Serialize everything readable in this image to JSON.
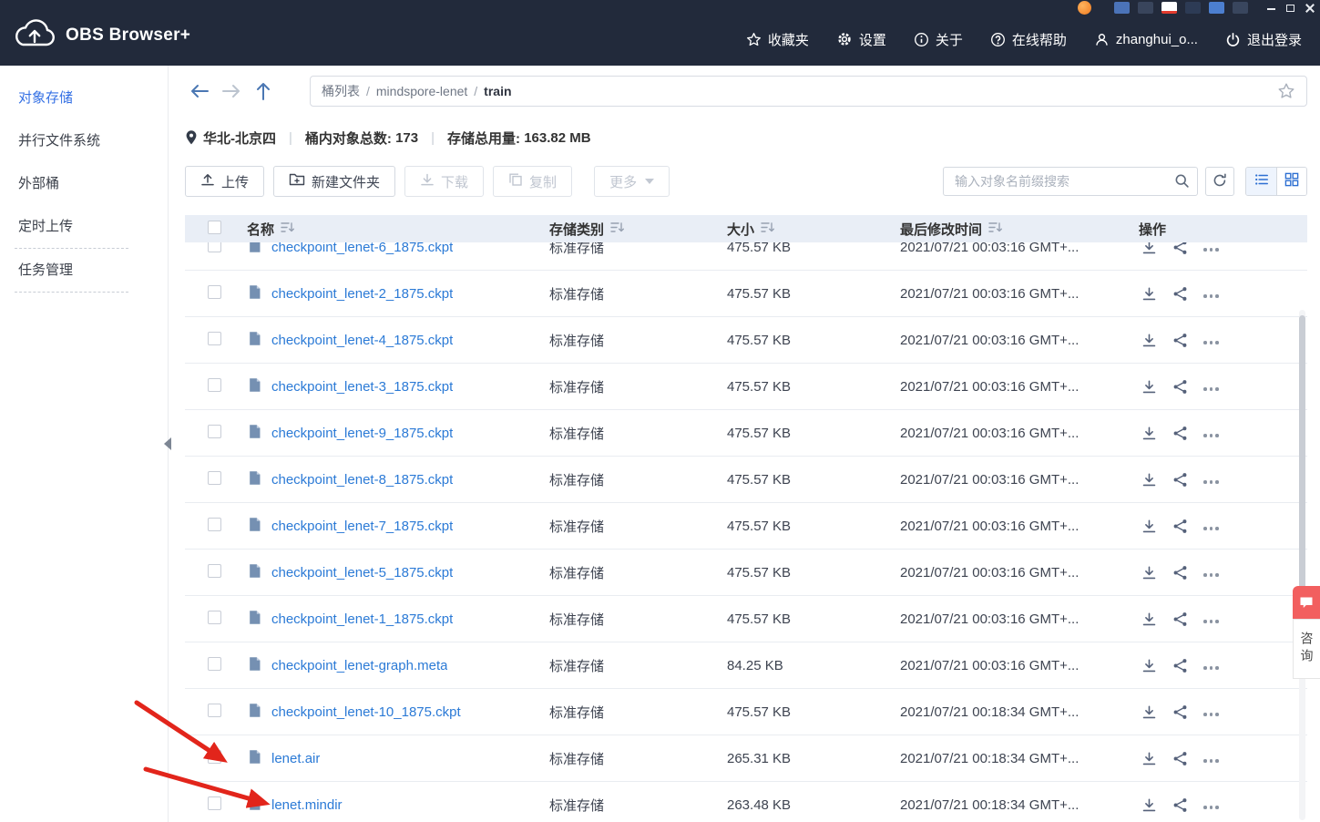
{
  "app": {
    "title": "OBS Browser+"
  },
  "tray": {
    "icons": [
      "orange-app-icon",
      "ime-icon",
      "keyboard-icon",
      "candidate-box-icon",
      "network-icon",
      "apps-grid-icon",
      "shield-icon"
    ],
    "window_controls": [
      "minimize",
      "maximize",
      "close"
    ]
  },
  "header": {
    "menu": [
      {
        "icon": "star-icon",
        "label": "收藏夹"
      },
      {
        "icon": "gear-icon",
        "label": "设置"
      },
      {
        "icon": "info-icon",
        "label": "关于"
      },
      {
        "icon": "help-icon",
        "label": "在线帮助"
      },
      {
        "icon": "user-icon",
        "label": "zhanghui_o..."
      },
      {
        "icon": "power-icon",
        "label": "退出登录"
      }
    ]
  },
  "sidebar": {
    "items": [
      {
        "label": "对象存储",
        "active": true
      },
      {
        "label": "并行文件系统",
        "active": false
      },
      {
        "label": "外部桶",
        "active": false
      },
      {
        "label": "定时上传",
        "active": false
      },
      {
        "label": "任务管理",
        "active": false
      }
    ]
  },
  "nav": {
    "breadcrumb": {
      "root": "桶列表",
      "bucket": "mindspore-lenet",
      "folder": "train",
      "separator": "/"
    }
  },
  "info": {
    "region": "华北-北京四",
    "divider": "|",
    "count_label": "桶内对象总数:",
    "count_value": "173",
    "usage_label": "存储总用量:",
    "usage_value": "163.82 MB"
  },
  "toolbar": {
    "upload": "上传",
    "new_folder": "新建文件夹",
    "download": "下载",
    "copy": "复制",
    "more": "更多",
    "search_placeholder": "输入对象名前缀搜索"
  },
  "table": {
    "headers": {
      "name": "名称",
      "storage": "存储类别",
      "size": "大小",
      "modified": "最后修改时间",
      "ops": "操作"
    },
    "rows": [
      {
        "name": "checkpoint_lenet-6_1875.ckpt",
        "storage": "标准存储",
        "size": "475.57 KB",
        "modified": "2021/07/21 00:03:16 GMT+..."
      },
      {
        "name": "checkpoint_lenet-2_1875.ckpt",
        "storage": "标准存储",
        "size": "475.57 KB",
        "modified": "2021/07/21 00:03:16 GMT+..."
      },
      {
        "name": "checkpoint_lenet-4_1875.ckpt",
        "storage": "标准存储",
        "size": "475.57 KB",
        "modified": "2021/07/21 00:03:16 GMT+..."
      },
      {
        "name": "checkpoint_lenet-3_1875.ckpt",
        "storage": "标准存储",
        "size": "475.57 KB",
        "modified": "2021/07/21 00:03:16 GMT+..."
      },
      {
        "name": "checkpoint_lenet-9_1875.ckpt",
        "storage": "标准存储",
        "size": "475.57 KB",
        "modified": "2021/07/21 00:03:16 GMT+..."
      },
      {
        "name": "checkpoint_lenet-8_1875.ckpt",
        "storage": "标准存储",
        "size": "475.57 KB",
        "modified": "2021/07/21 00:03:16 GMT+..."
      },
      {
        "name": "checkpoint_lenet-7_1875.ckpt",
        "storage": "标准存储",
        "size": "475.57 KB",
        "modified": "2021/07/21 00:03:16 GMT+..."
      },
      {
        "name": "checkpoint_lenet-5_1875.ckpt",
        "storage": "标准存储",
        "size": "475.57 KB",
        "modified": "2021/07/21 00:03:16 GMT+..."
      },
      {
        "name": "checkpoint_lenet-1_1875.ckpt",
        "storage": "标准存储",
        "size": "475.57 KB",
        "modified": "2021/07/21 00:03:16 GMT+..."
      },
      {
        "name": "checkpoint_lenet-graph.meta",
        "storage": "标准存储",
        "size": "84.25 KB",
        "modified": "2021/07/21 00:03:16 GMT+..."
      },
      {
        "name": "checkpoint_lenet-10_1875.ckpt",
        "storage": "标准存储",
        "size": "475.57 KB",
        "modified": "2021/07/21 00:18:34 GMT+..."
      },
      {
        "name": "lenet.air",
        "storage": "标准存储",
        "size": "265.31 KB",
        "modified": "2021/07/21 00:18:34 GMT+..."
      },
      {
        "name": "lenet.mindir",
        "storage": "标准存储",
        "size": "263.48 KB",
        "modified": "2021/07/21 00:18:34 GMT+..."
      }
    ]
  },
  "consult": {
    "label": "咨询"
  }
}
